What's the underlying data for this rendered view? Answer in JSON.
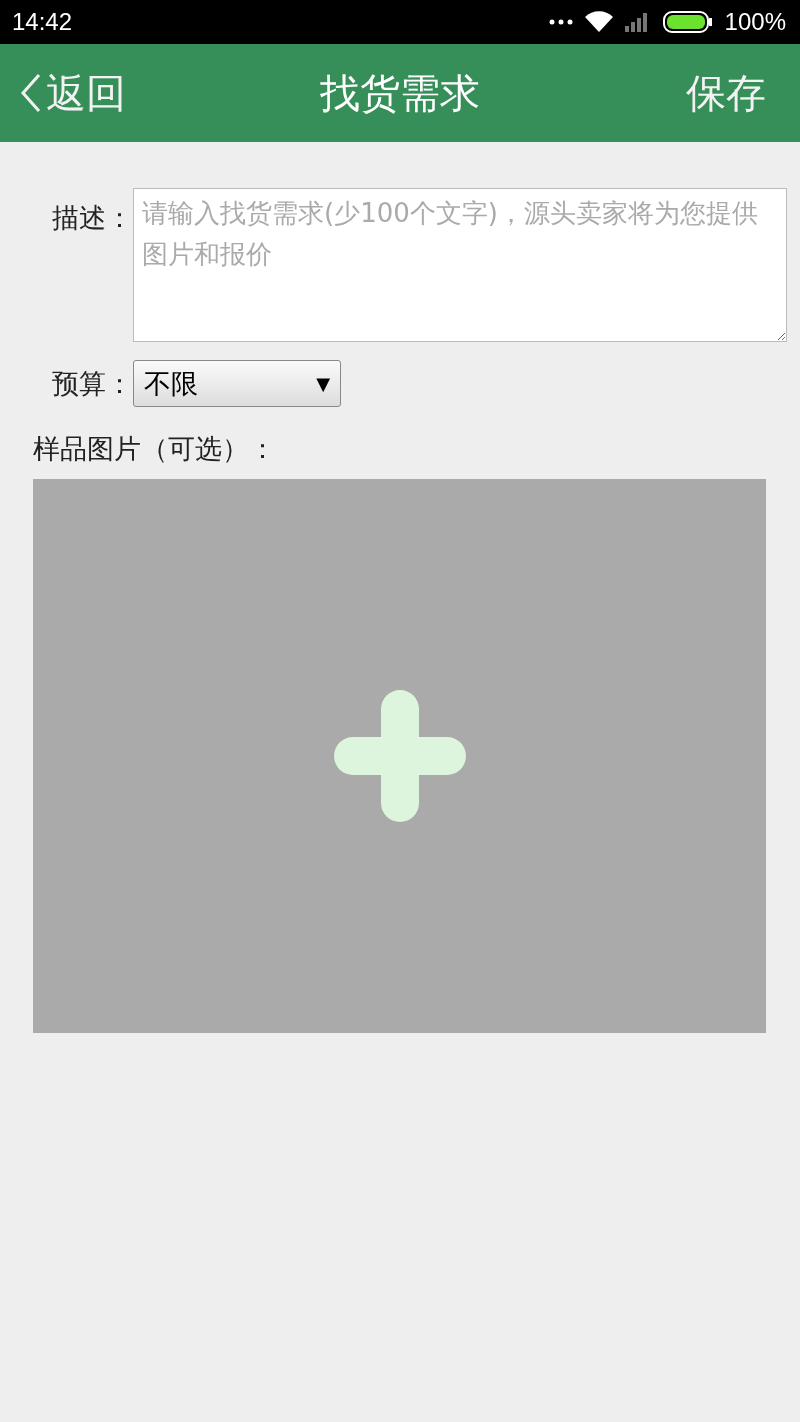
{
  "status_bar": {
    "time": "14:42",
    "battery": "100%"
  },
  "nav_bar": {
    "back": "返回",
    "title": "找货需求",
    "action": "保存"
  },
  "form": {
    "description": {
      "label": "描述：",
      "placeholder": "请输入找货需求(少100个文字)，源头卖家将为您提供图片和报价"
    },
    "budget": {
      "label": "预算：",
      "value": "不限",
      "arrow": "▼"
    },
    "sample_images": {
      "label": "样品图片（可选）："
    }
  }
}
